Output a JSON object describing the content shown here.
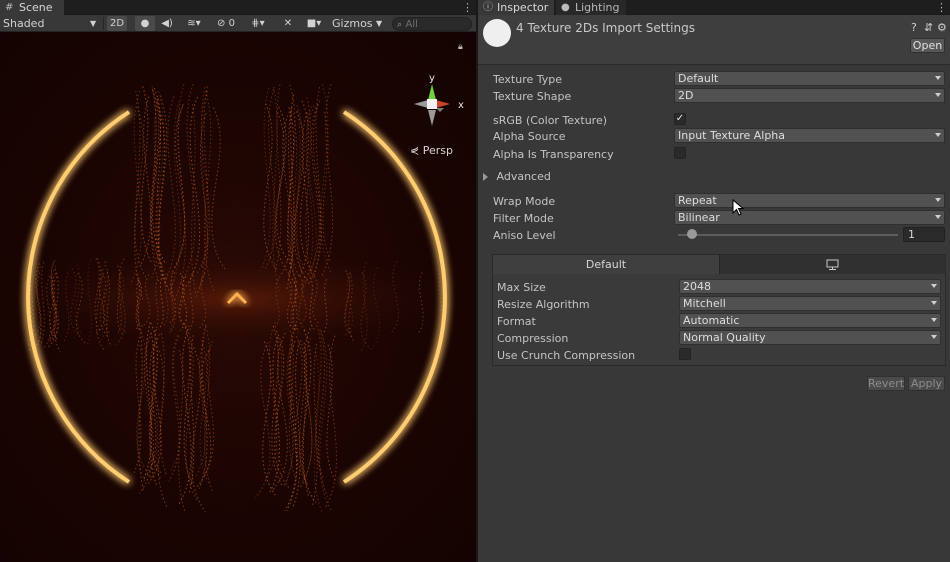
{
  "scene": {
    "tab_label": "Scene",
    "shading_mode": "Shaded",
    "mode_2d": "2D",
    "hidden_count": "0",
    "gizmos_label": "Gizmos",
    "search_placeholder": "All",
    "persp_label": "Persp",
    "axis_y": "y",
    "axis_x": "x"
  },
  "inspector": {
    "tab_label": "Inspector",
    "lighting_tab_label": "Lighting",
    "title": "4 Texture 2Ds Import Settings",
    "open_label": "Open",
    "properties": {
      "texture_type": {
        "label": "Texture Type",
        "value": "Default"
      },
      "texture_shape": {
        "label": "Texture Shape",
        "value": "2D"
      },
      "srgb": {
        "label": "sRGB (Color Texture)",
        "checked": true
      },
      "alpha_source": {
        "label": "Alpha Source",
        "value": "Input Texture Alpha"
      },
      "alpha_is_transparency": {
        "label": "Alpha Is Transparency",
        "checked": false
      },
      "advanced_label": "Advanced",
      "wrap_mode": {
        "label": "Wrap Mode",
        "value": "Repeat"
      },
      "filter_mode": {
        "label": "Filter Mode",
        "value": "Bilinear"
      },
      "aniso_level": {
        "label": "Aniso Level",
        "value": "1"
      }
    },
    "platform": {
      "default_tab": "Default",
      "max_size": {
        "label": "Max Size",
        "value": "2048"
      },
      "resize_algorithm": {
        "label": "Resize Algorithm",
        "value": "Mitchell"
      },
      "format": {
        "label": "Format",
        "value": "Automatic"
      },
      "compression": {
        "label": "Compression",
        "value": "Normal Quality"
      },
      "use_crunch": {
        "label": "Use Crunch Compression",
        "checked": false
      }
    },
    "revert_label": "Revert",
    "apply_label": "Apply"
  },
  "colors": {
    "glow": "#ffc060",
    "strands": "#b85a22",
    "panel_bg": "#383838"
  }
}
